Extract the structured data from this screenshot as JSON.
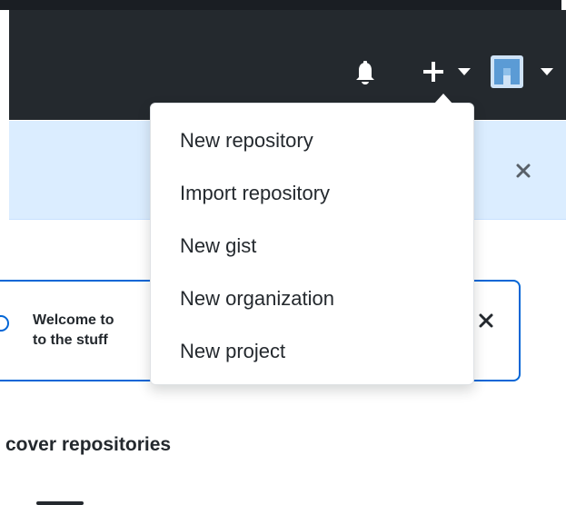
{
  "header": {
    "icons": {
      "notifications": "bell-icon",
      "create": "plus-icon",
      "create_caret": "caret-down-icon",
      "avatar": "avatar-icon",
      "avatar_caret": "caret-down-icon"
    }
  },
  "flash": {
    "close_icon": "close-icon"
  },
  "welcome": {
    "line1": "Welcome to",
    "line2": "to the stuff",
    "close_icon": "close-icon"
  },
  "dropdown": {
    "items": [
      {
        "label": "New repository"
      },
      {
        "label": "Import repository"
      },
      {
        "label": "New gist"
      },
      {
        "label": "New organization"
      },
      {
        "label": "New project"
      }
    ]
  },
  "main": {
    "section_title": "cover repositories"
  },
  "colors": {
    "header_bg": "#24292e",
    "flash_bg": "#dbedff",
    "accent": "#0366d6",
    "text": "#24292e"
  }
}
